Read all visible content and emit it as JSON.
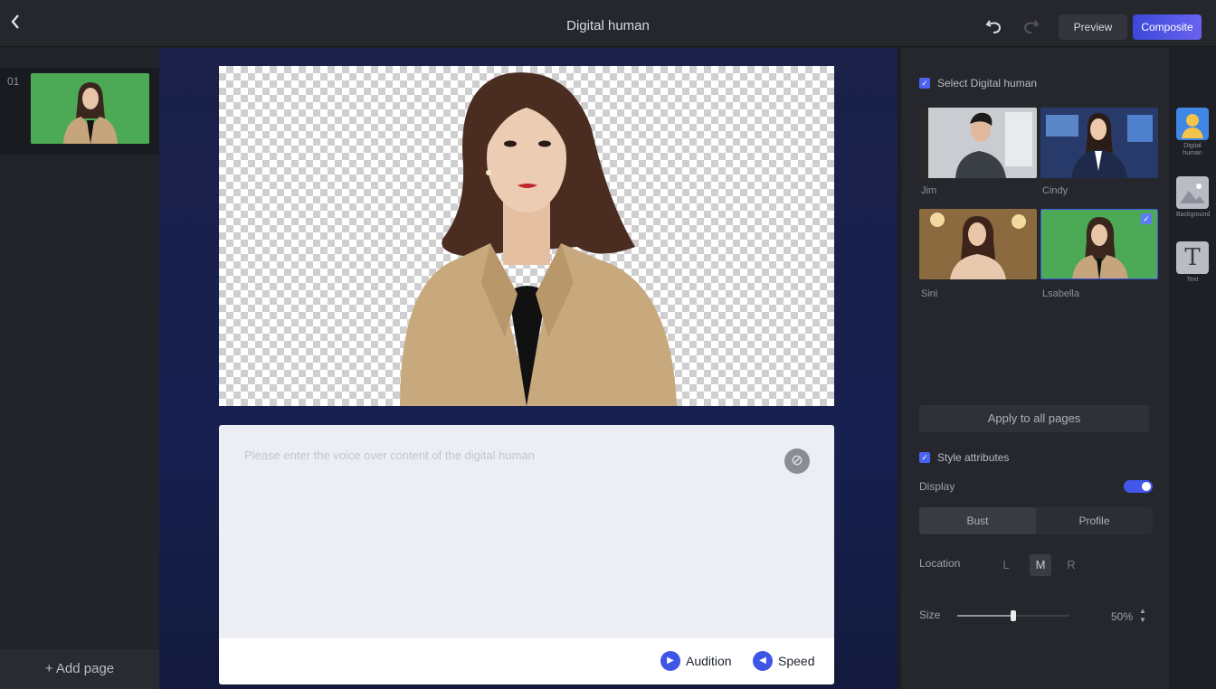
{
  "header": {
    "title": "Digital human",
    "back_icon": "chevron-left-icon",
    "preview_label": "Preview",
    "compose_label": "Composite"
  },
  "pages": {
    "items": [
      {
        "number": "01"
      }
    ],
    "add_label": "+ Add page"
  },
  "editor": {
    "script_placeholder": "Please enter the voice over content of the digital human",
    "audition_label": "Audition",
    "speed_label": "Speed"
  },
  "settings": {
    "select_human_label": "Select Digital human",
    "avatars": [
      {
        "name": "Jim",
        "selected": false
      },
      {
        "name": "Cindy",
        "selected": false
      },
      {
        "name": "Sini",
        "selected": false
      },
      {
        "name": "Lsabella",
        "selected": true
      }
    ],
    "apply_all_label": "Apply to all pages",
    "style_label": "Style attributes",
    "display_label": "Display",
    "display_on": true,
    "crop_options": [
      "Bust",
      "Profile"
    ],
    "crop_selected": "Bust",
    "location_label": "Location",
    "location_options": [
      "L",
      "M",
      "R"
    ],
    "location_selected": "M",
    "size_label": "Size",
    "size_value": "50%",
    "size_fraction": 0.5
  },
  "tools": [
    {
      "label": "Digital human",
      "icon": "digital-human-icon"
    },
    {
      "label": "Background",
      "icon": "image-icon"
    },
    {
      "label": "Text",
      "icon": "text-icon"
    }
  ],
  "colors": {
    "accent": "#4257e8",
    "green_screen": "#4caa56"
  }
}
